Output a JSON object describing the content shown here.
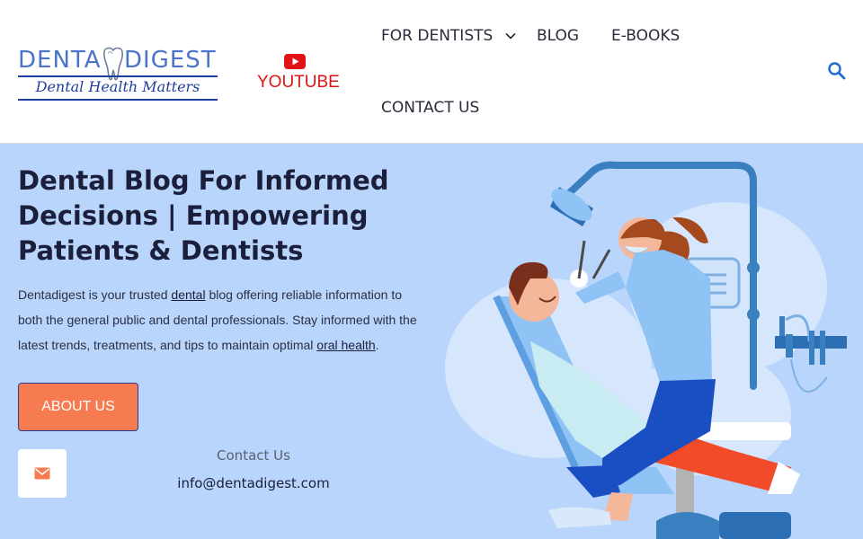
{
  "header": {
    "logo": {
      "word1": "DENTA",
      "word2": "DIGEST",
      "tagline": "Dental Health Matters"
    },
    "youtube_label": "YOUTUBE",
    "nav": {
      "for_dentists": "FOR DENTISTS",
      "blog": "BLOG",
      "ebooks": "E-BOOKS",
      "contact_us": "CONTACT US"
    }
  },
  "hero": {
    "title": "Dental Blog For Informed Decisions | Empowering Patients & Dentists",
    "desc_part1": "Dentadigest is your trusted ",
    "desc_link1": "dental",
    "desc_part2": " blog offering reliable information to both the general public and dental professionals. Stay informed with the latest trends, treatments, and tips to maintain optimal ",
    "desc_link2": "oral health",
    "desc_part3": ".",
    "about_button": "ABOUT US",
    "contact_label": "Contact Us",
    "contact_email": "info@dentadigest.com"
  },
  "colors": {
    "hero_bg": "#b9d5fb",
    "accent_button": "#f77b51",
    "youtube_red": "#e01414",
    "logo_blue": "#4a74c9",
    "search_blue": "#1f6fd1"
  },
  "icons": {
    "youtube": "youtube-icon",
    "chevron": "chevron-down-icon",
    "search": "search-icon",
    "mail": "mail-icon",
    "logo_tooth": "tooth-icon",
    "illustration": "dentist-patient-illustration"
  }
}
